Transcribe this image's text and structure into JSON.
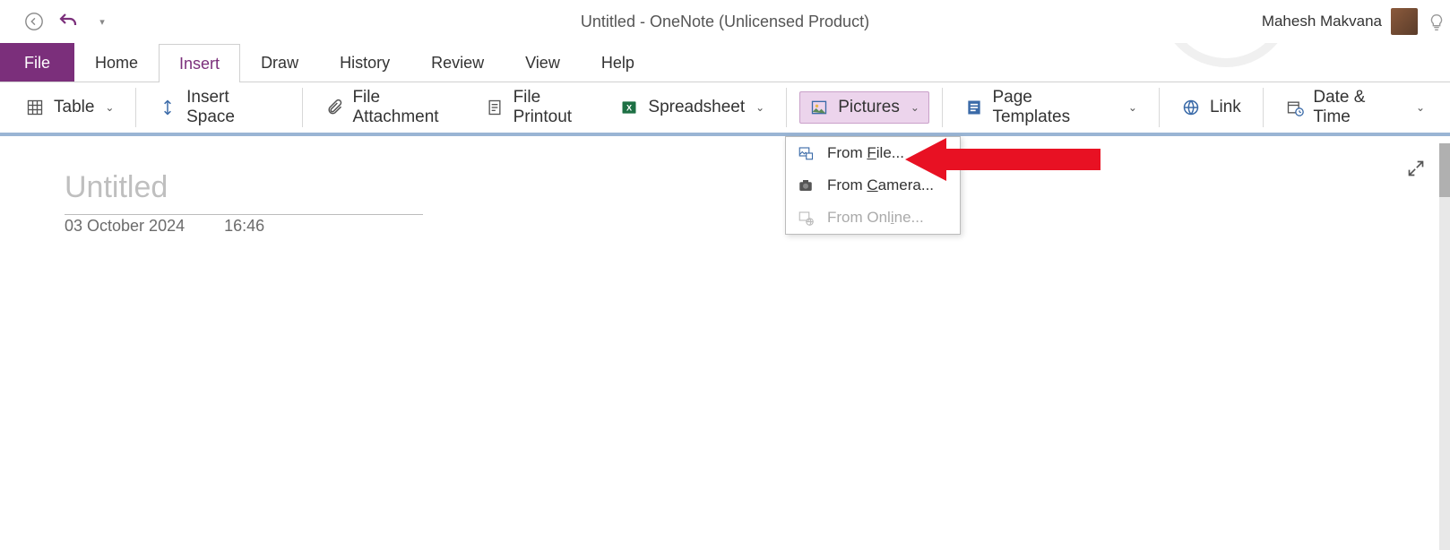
{
  "titlebar": {
    "title": "Untitled  -  OneNote (Unlicensed Product)",
    "user_name": "Mahesh Makvana"
  },
  "tabs": {
    "file": "File",
    "home": "Home",
    "insert": "Insert",
    "draw": "Draw",
    "history": "History",
    "review": "Review",
    "view": "View",
    "help": "Help"
  },
  "ribbon": {
    "table": "Table",
    "insert_space": "Insert Space",
    "file_attachment": "File Attachment",
    "file_printout": "File Printout",
    "spreadsheet": "Spreadsheet",
    "pictures": "Pictures",
    "page_templates": "Page Templates",
    "link": "Link",
    "date_time": "Date & Time"
  },
  "pictures_menu": {
    "from_file_pre": "From ",
    "from_file_u": "F",
    "from_file_post": "ile...",
    "from_camera_pre": "From ",
    "from_camera_u": "C",
    "from_camera_post": "amera...",
    "from_online_pre": "From Onl",
    "from_online_u": "i",
    "from_online_post": "ne..."
  },
  "page": {
    "title_placeholder": "Untitled",
    "date": "03 October 2024",
    "time": "16:46"
  }
}
